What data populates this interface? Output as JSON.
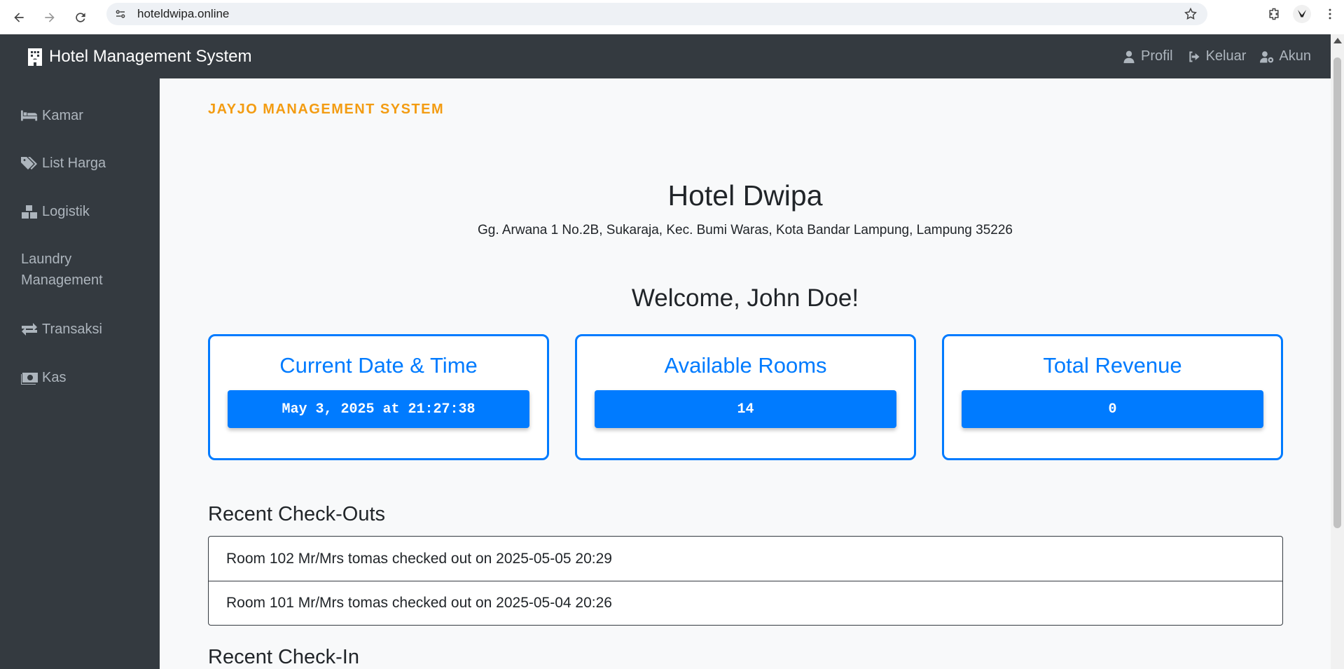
{
  "browser": {
    "url": "hoteldwipa.online"
  },
  "navbar": {
    "brand": "Hotel Management System",
    "links": [
      {
        "label": "Profil",
        "icon": "user-icon"
      },
      {
        "label": "Keluar",
        "icon": "sign-out-icon"
      },
      {
        "label": "Akun",
        "icon": "user-cog-icon"
      }
    ]
  },
  "sidebar": {
    "items": [
      {
        "label": "Kamar",
        "icon": "bed-icon"
      },
      {
        "label": "List Harga",
        "icon": "tags-icon"
      },
      {
        "label": "Logistik",
        "icon": "boxes-icon"
      },
      {
        "label": "Laundry Management",
        "icon": ""
      },
      {
        "label": "Transaksi",
        "icon": "exchange-icon"
      },
      {
        "label": "Kas",
        "icon": "money-icon"
      }
    ]
  },
  "main": {
    "system_title": "JAYJO MANAGEMENT SYSTEM",
    "hotel_name": "Hotel Dwipa",
    "hotel_address": "Gg. Arwana 1 No.2B, Sukaraja, Kec. Bumi Waras, Kota Bandar Lampung, Lampung 35226",
    "welcome": "Welcome, John Doe!",
    "cards": [
      {
        "title": "Current Date & Time",
        "value": "May 3, 2025 at 21:27:38"
      },
      {
        "title": "Available Rooms",
        "value": "14"
      },
      {
        "title": "Total Revenue",
        "value": "0"
      }
    ],
    "recent_checkouts_title": "Recent Check-Outs",
    "recent_checkouts": [
      "Room 102 Mr/Mrs tomas checked out on 2025-05-05 20:29",
      "Room 101 Mr/Mrs tomas checked out on 2025-05-04 20:26"
    ],
    "recent_checkins_title": "Recent Check-In"
  },
  "colors": {
    "sidebar_bg": "#343a40",
    "accent": "#007bff",
    "system_title": "#f39c12",
    "main_bg": "#f8f9fa"
  }
}
